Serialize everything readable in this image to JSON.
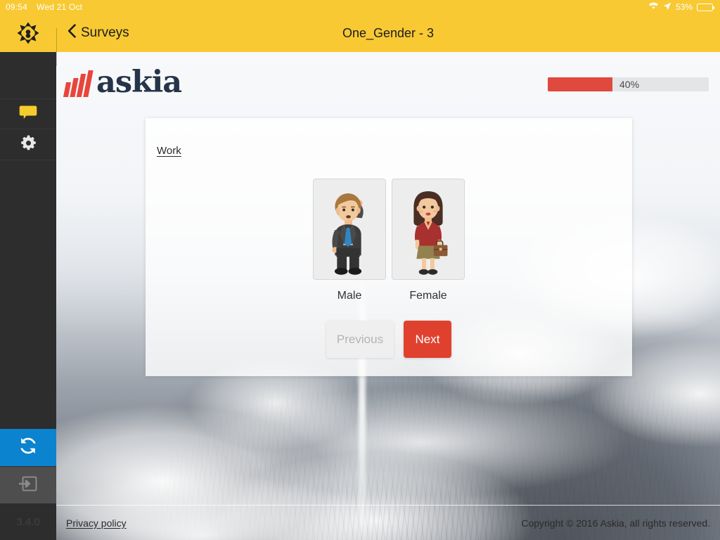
{
  "status_bar": {
    "time": "09:54",
    "date": "Wed 21 Oct",
    "wifi_icon": "wifi-icon",
    "location_icon": "location-arrow-icon",
    "battery_percent": "53%",
    "battery_level": 53
  },
  "nav": {
    "app_icon": "expand-arrows-icon",
    "back_icon": "chevron-left-icon",
    "back_label": "Surveys",
    "title": "One_Gender - 3",
    "background_color": "#f8c933"
  },
  "sidebar": {
    "items": [
      {
        "name": "chat",
        "icon": "speech-bubble-icon",
        "color": "#f5cc2b"
      },
      {
        "name": "settings",
        "icon": "gear-icon",
        "color": "#e8e8e8"
      }
    ],
    "sync": {
      "name": "sync",
      "icon": "sync-refresh-icon",
      "color": "#0c83ce"
    },
    "logout": {
      "name": "logout",
      "icon": "exit-arrow-icon",
      "color": "#4e4e4e"
    },
    "version": "3.4.0"
  },
  "survey": {
    "brand": "askia",
    "brand_text_color": "#253449",
    "brand_bar_color": "#e8453c",
    "progress": {
      "label": "40%",
      "value": 40,
      "fill_color": "#e0493e",
      "track_color": "#e3e5e6"
    },
    "question": {
      "title": "Work",
      "options": [
        {
          "label": "Male",
          "illustration": "businessman-illustration"
        },
        {
          "label": "Female",
          "illustration": "businesswoman-illustration"
        }
      ]
    },
    "buttons": {
      "previous": "Previous",
      "previous_disabled": true,
      "next": "Next",
      "next_color": "#e0412f"
    }
  },
  "footer": {
    "privacy_link": "Privacy policy",
    "copyright": "Copyright © 2016 Askia, all rights reserved."
  }
}
